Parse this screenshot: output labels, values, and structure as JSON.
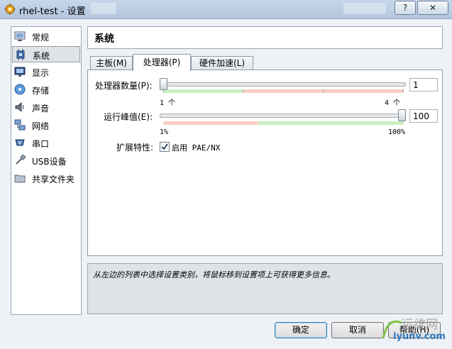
{
  "window": {
    "title": "rhel-test - 设置",
    "help_btn": "?",
    "close_btn": "✕"
  },
  "sidebar": {
    "items": [
      {
        "label": "常规",
        "icon": "monitor-general-icon"
      },
      {
        "label": "系统",
        "icon": "chip-system-icon",
        "selected": true
      },
      {
        "label": "显示",
        "icon": "display-icon"
      },
      {
        "label": "存储",
        "icon": "storage-disk-icon"
      },
      {
        "label": "声音",
        "icon": "speaker-icon"
      },
      {
        "label": "网络",
        "icon": "network-icon"
      },
      {
        "label": "串口",
        "icon": "serial-port-icon"
      },
      {
        "label": "USB设备",
        "icon": "usb-icon"
      },
      {
        "label": "共享文件夹",
        "icon": "folder-icon"
      }
    ]
  },
  "page": {
    "title": "系统"
  },
  "tabs": [
    {
      "label": "主板(M)"
    },
    {
      "label": "处理器(P)",
      "active": true
    },
    {
      "label": "硬件加速(L)"
    }
  ],
  "processor": {
    "cpu_count_label": "处理器数量(P):",
    "cpu_count_value": "1",
    "cpu_min_label": "1 个",
    "cpu_max_label": "4 个",
    "cpu_count": 1,
    "cpu_max": 4,
    "exec_cap_label": "运行峰值(E):",
    "exec_cap_value": "100",
    "exec_min_label": "1%",
    "exec_max_label": "100%",
    "exec_cap": 100,
    "ext_label": "扩展特性:",
    "pae_label": "启用 PAE/NX",
    "pae_checked": true
  },
  "description": "从左边的列表中选择设置类别，将鼠标移到设置项上可获得更多信息。",
  "buttons": {
    "ok": "确定",
    "cancel": "取消",
    "help": "帮助(H)"
  },
  "watermark": {
    "text_cn": "运维网",
    "text_url": "iyunv.com"
  },
  "colors": {
    "green_zone": "#c9efc1",
    "red_zone": "#f6cfc2",
    "accent": "#3c7fb1"
  }
}
